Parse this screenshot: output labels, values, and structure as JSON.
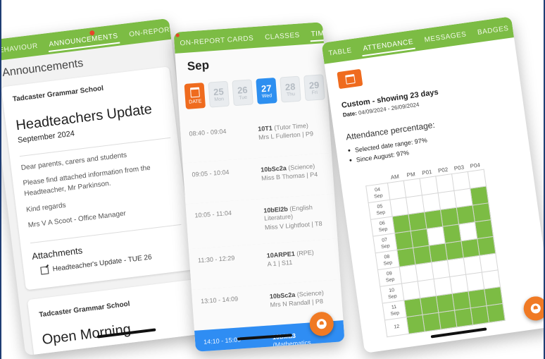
{
  "phone1": {
    "tabs": [
      "BEHAVIOUR",
      "ANNOUNCEMENTS",
      "ON-REPORT C"
    ],
    "page_title": "Announcements",
    "card1": {
      "school": "Tadcaster Grammar School",
      "headline": "Headteachers Update",
      "subhead": "September 2024",
      "lines": [
        "Dear parents, carers and students",
        "Please find attached information from the Headteacher, Mr Parkinson.",
        "Kind regards",
        "Mrs V A Scoot - Office Manager"
      ],
      "attachments_title": "Attachments",
      "attachment": "Headteacher's Update - TUE 26"
    },
    "card2": {
      "school": "Tadcaster Grammar School",
      "headline": "Open Morning"
    }
  },
  "phone2": {
    "tabs": [
      "ON-REPORT CARDS",
      "CLASSES",
      "TIME"
    ],
    "month": "Sep",
    "date_label": "DATE",
    "days": [
      {
        "num": "25",
        "dow": "Mon"
      },
      {
        "num": "26",
        "dow": "Tue"
      },
      {
        "num": "27",
        "dow": "Wed"
      },
      {
        "num": "28",
        "dow": "Thu"
      },
      {
        "num": "29",
        "dow": "Fri"
      }
    ],
    "lessons": [
      {
        "time": "08:40 - 09:04",
        "code": "10T1",
        "subject": "(Tutor Time)",
        "teacher": "Mrs L Fullerton | P9"
      },
      {
        "time": "09:05 - 10:04",
        "code": "10bSc2a",
        "subject": "(Science)",
        "teacher": "Miss B Thomas | P4"
      },
      {
        "time": "10:05 - 11:04",
        "code": "10bEl2b",
        "subject": "(English Literature)",
        "teacher": "Miss V Lightfoot | T8"
      },
      {
        "time": "11:30 - 12:29",
        "code": "10ARPE1",
        "subject": "(RPE)",
        "teacher": "A 1 | S11"
      },
      {
        "time": "13:10 - 14:09",
        "code": "10bSc2a",
        "subject": "(Science)",
        "teacher": "Mrs N Randall | P8"
      },
      {
        "time": "14:10 - 15:09",
        "code": "10bMa3",
        "subject": "(Mathematics",
        "teacher": "Mr M McKie |"
      }
    ]
  },
  "phone3": {
    "tabs": [
      "TABLE",
      "ATTENDANCE",
      "MESSAGES",
      "BADGES"
    ],
    "custom": "Custom - showing 23 days",
    "date_key": "Date:",
    "date_range": "04/09/2024 - 26/09/2024",
    "att_title": "Attendance percentage:",
    "bullets": [
      "Selected date range: 97%",
      "Since August: 97%"
    ],
    "columns": [
      "AM",
      "PM",
      "P01",
      "P02",
      "P03",
      "P04"
    ],
    "rows": [
      {
        "day": "04",
        "mon": "Sep",
        "cells": [
          0,
          0,
          0,
          0,
          0,
          0
        ]
      },
      {
        "day": "05",
        "mon": "Sep",
        "cells": [
          0,
          0,
          0,
          0,
          0,
          1
        ]
      },
      {
        "day": "06",
        "mon": "Sep",
        "cells": [
          1,
          1,
          1,
          1,
          1,
          1
        ]
      },
      {
        "day": "07",
        "mon": "Sep",
        "cells": [
          1,
          1,
          0,
          1,
          0,
          1
        ]
      },
      {
        "day": "08",
        "mon": "Sep",
        "cells": [
          1,
          1,
          1,
          1,
          1,
          1
        ]
      },
      {
        "day": "09",
        "mon": "Sep",
        "cells": [
          0,
          0,
          0,
          0,
          0,
          0
        ]
      },
      {
        "day": "10",
        "mon": "Sep",
        "cells": [
          0,
          0,
          0,
          0,
          0,
          0
        ]
      },
      {
        "day": "11",
        "mon": "Sep",
        "cells": [
          1,
          1,
          1,
          1,
          1,
          1
        ]
      },
      {
        "day": "12",
        "mon": "",
        "cells": [
          1,
          1,
          1,
          1,
          1,
          1
        ]
      }
    ]
  },
  "colors": {
    "tabbar": "#7cbc44",
    "orange": "#ef6b1e",
    "blue": "#2f8df3",
    "present": "#7cbc44"
  }
}
